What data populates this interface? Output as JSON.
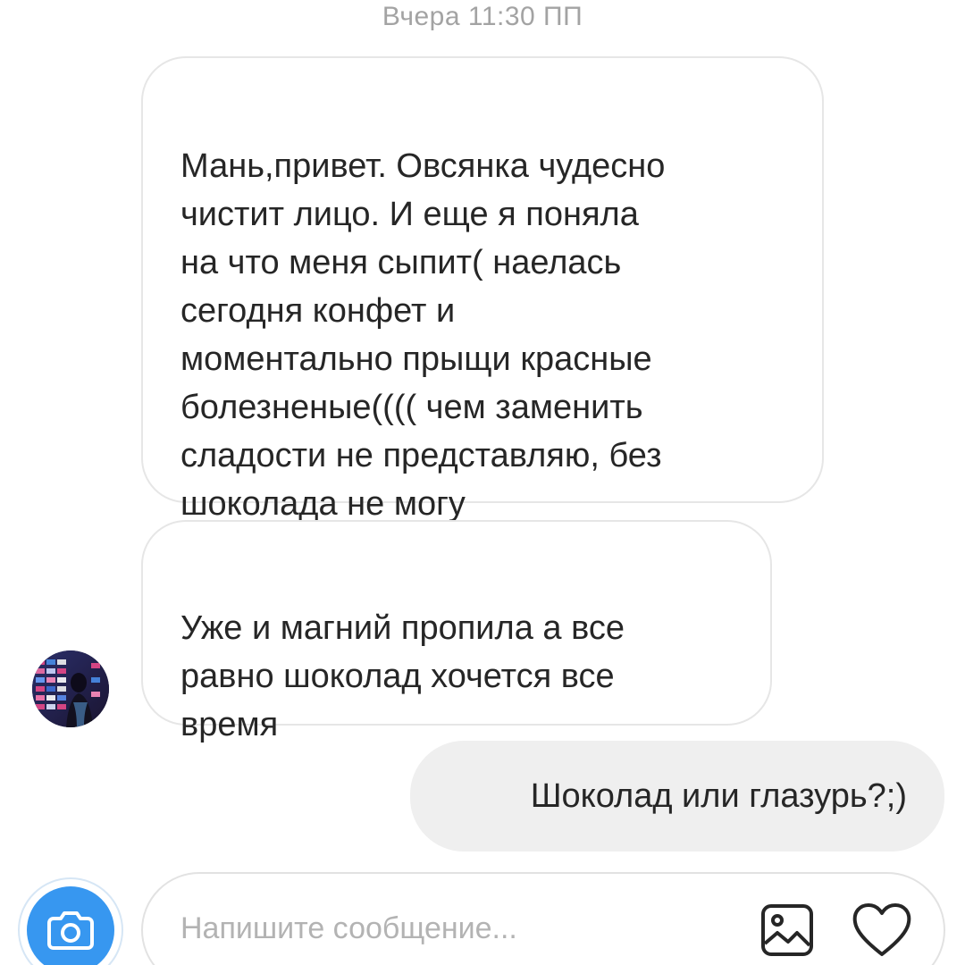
{
  "header": {
    "timestamp": "Вчера 11:30 ПП"
  },
  "messages": [
    {
      "direction": "incoming",
      "text": "Мань,привет. Овсянка чудесно\nчистит лицо.  И еще я поняла\nна что меня сыпит( наелась\nсегодня конфет и\nмоментально прыщи красные\nболезненые(((( чем заменить\nсладости не представляю, без\nшоколада не могу"
    },
    {
      "direction": "incoming",
      "text": "Уже и магний пропила а все\nравно шоколад хочется все\nвремя"
    },
    {
      "direction": "outgoing",
      "text": "Шоколад или глазурь?;)"
    }
  ],
  "composer": {
    "placeholder": "Напишите сообщение...",
    "camera_icon": "camera-icon",
    "gallery_icon": "gallery-icon",
    "like_icon": "heart-icon"
  },
  "colors": {
    "accent": "#3797f0",
    "incoming_border": "#e6e6e6",
    "outgoing_bg": "#efefef",
    "meta_text": "#a3a3a3",
    "placeholder": "#b3b3b3"
  }
}
